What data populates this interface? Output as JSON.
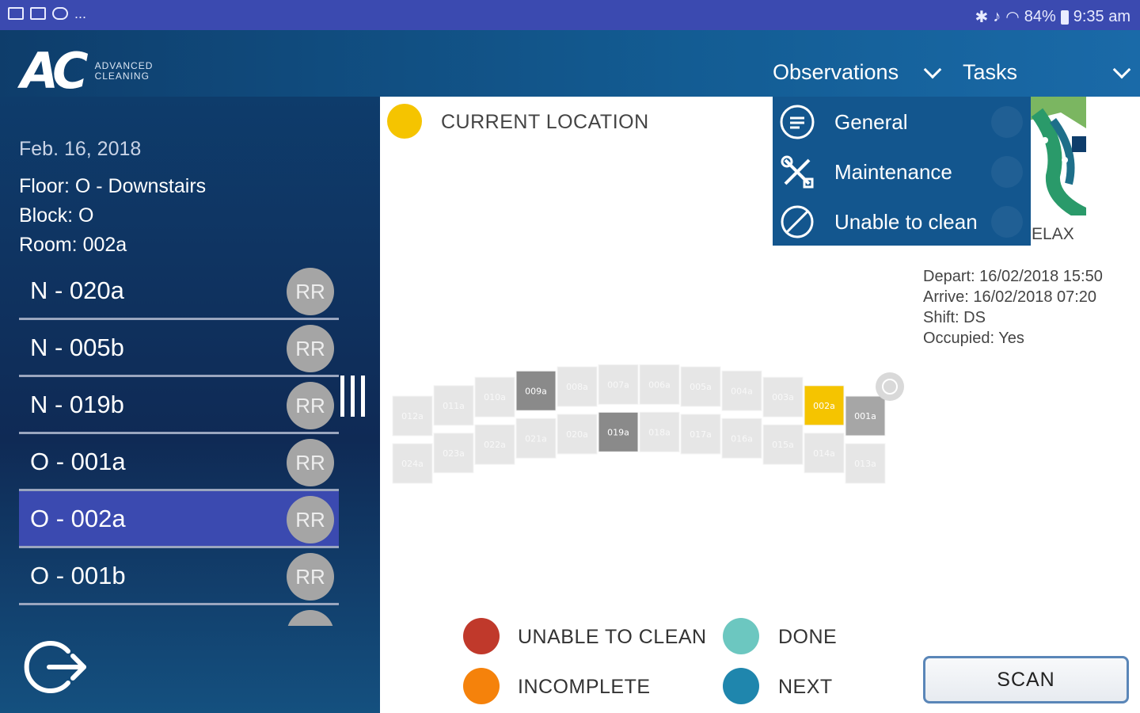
{
  "status_bar": {
    "battery": "84%",
    "time": "9:35 am",
    "more": "..."
  },
  "logo": {
    "mark": "AC",
    "sub_line1": "ADVANCED",
    "sub_line2": "CLEANING"
  },
  "header": {
    "observations_label": "Observations",
    "tasks_label": "Tasks"
  },
  "dropdown": {
    "items": [
      {
        "label": "General",
        "icon": "chat-icon"
      },
      {
        "label": "Maintenance",
        "icon": "tools-icon"
      },
      {
        "label": "Unable to clean",
        "icon": "prohibited-icon"
      }
    ]
  },
  "sidebar": {
    "date": "Feb. 16, 2018",
    "floor": "Floor: O - Downstairs",
    "block": "Block: O",
    "room": "Room: 002a",
    "rooms": [
      {
        "label": "N - 020a",
        "badge": "RR",
        "active": false
      },
      {
        "label": "N - 005b",
        "badge": "RR",
        "active": false
      },
      {
        "label": "N - 019b",
        "badge": "RR",
        "active": false
      },
      {
        "label": "O - 001a",
        "badge": "RR",
        "active": false
      },
      {
        "label": "O - 002a",
        "badge": "RR",
        "active": true
      },
      {
        "label": "O - 001b",
        "badge": "RR",
        "active": false
      },
      {
        "label": "",
        "badge": "",
        "active": false
      }
    ]
  },
  "main": {
    "current_location_label": "CURRENT LOCATION",
    "relax_label": "ELAX",
    "details": {
      "depart": "Depart: 16/02/2018 15:50",
      "arrive": "Arrive: 16/02/2018 07:20",
      "shift": "Shift: DS",
      "occupied": "Occupied: Yes"
    },
    "seat_rows": {
      "top": [
        "012a",
        "011a",
        "010a",
        "009a",
        "008a",
        "007a",
        "006a",
        "005a",
        "004a",
        "003a",
        "002a",
        "001a"
      ],
      "bottom": [
        "024a",
        "023a",
        "022a",
        "021a",
        "020a",
        "019a",
        "018a",
        "017a",
        "016a",
        "015a",
        "014a",
        "013a"
      ],
      "highlighted": "002a",
      "dark": [
        "009a",
        "019a",
        "001a"
      ]
    },
    "legend": [
      {
        "label": "UNABLE TO CLEAN",
        "color": "#c0392b"
      },
      {
        "label": "DONE",
        "color": "#6cc7c0"
      },
      {
        "label": "INCOMPLETE",
        "color": "#f5820b"
      },
      {
        "label": "NEXT",
        "color": "#1f86ad"
      }
    ],
    "scan_label": "SCAN"
  },
  "colors": {
    "status_bar": "#3b4ab0",
    "active_row": "#3b4ab0",
    "current_location": "#f5c400",
    "badge": "#a5a5a5"
  }
}
